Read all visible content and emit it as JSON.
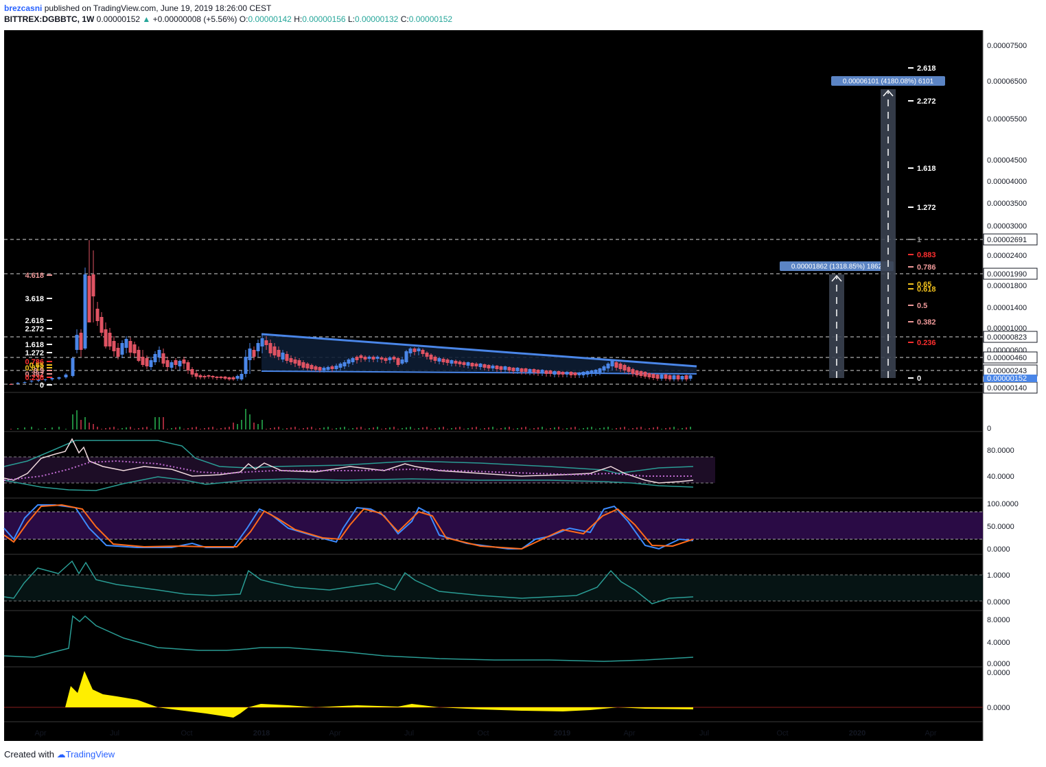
{
  "header": {
    "user": "brezcasni",
    "published": "published on TradingView.com, June 19, 2019 18:26:00 CEST",
    "symbol": "BITTREX:DGBBTC, 1W",
    "price": "0.00000152",
    "change": "+0.00000008 (+5.56%)",
    "o_label": "O:",
    "o_value": "0.00000142",
    "h_label": "H:",
    "h_value": "0.00000156",
    "l_label": "L:",
    "l_value": "0.00000132",
    "c_label": "C:",
    "c_value": "0.00000152"
  },
  "footer": {
    "created": "Created with",
    "brand": "TradingView"
  },
  "colors": {
    "background": "#000000",
    "bull": "#4a86e8",
    "bear": "#e05363",
    "trendline": "#4a86e8",
    "stoch_k": "#3d8bff",
    "stoch_d": "#ff6b1a",
    "teal": "#2a9d95",
    "yellow": "#ffee00",
    "rsi": "#f3dce0",
    "rsi_ma": "#c46ed6",
    "fib_white": "#ffffff",
    "fib_red": "#ff2f2f",
    "fib_pink": "#f09a9a",
    "fib_gold": "#f2c21d"
  },
  "x_axis_labels": [
    "Apr",
    "Jul",
    "Oct",
    "2018",
    "Apr",
    "Jul",
    "Oct",
    "2019",
    "Apr",
    "Jul",
    "Oct",
    "2020",
    "Apr"
  ],
  "price_axis": {
    "ticks": [
      "0.00007500",
      "0.00006500",
      "0.00005500",
      "0.00004500",
      "0.00004000",
      "0.00003500",
      "0.00003000",
      "0.00002400",
      "0.00001800",
      "0.00001400",
      "0.00001000",
      "0.00000600"
    ],
    "boxed": [
      "0.00002691",
      "0.00001990",
      "0.00000823",
      "0.00000460",
      "0.00000243",
      "0.00000140"
    ],
    "current": "0.00000152"
  },
  "volume_axis": [
    "0"
  ],
  "rsi_axis": [
    "80.0000",
    "40.0000"
  ],
  "stoch_axis": [
    "100.0000",
    "50.0000",
    "0.0000"
  ],
  "osc3_axis": [
    "1.0000",
    "0.0000"
  ],
  "osc4_axis": [
    "8.0000",
    "4.0000",
    "0.0000"
  ],
  "osc5_axis": [
    "0.0000",
    "0.0000"
  ],
  "fib_right": [
    "2.618",
    "2.272",
    "1.618",
    "1.272",
    "1",
    "0.883",
    "0.786",
    "0.65",
    "0.618",
    "0.5",
    "0.382",
    "0.236",
    "0"
  ],
  "fib_left": [
    "4.618",
    "3.618",
    "2.618",
    "2.272",
    "1.618",
    "1.272",
    "0.786",
    "0.65",
    "0.618",
    "0.5",
    "0.382",
    "0.236",
    "0"
  ],
  "projection_1": "0.00001862 (1318.85%) 1862",
  "projection_2": "0.00006101 (4180.08%) 6101",
  "chart_data": {
    "type": "candlestick",
    "symbol": "BITTREX:DGBBTC",
    "interval": "1W",
    "scale": "log",
    "last": {
      "open": 1.42e-06,
      "high": 1.56e-06,
      "low": 1.32e-06,
      "close": 1.52e-06,
      "change": 8e-08,
      "change_pct": 5.56
    },
    "price_levels_marked": [
      2.691e-05,
      1.99e-05,
      8.23e-06,
      4.6e-06,
      2.43e-06,
      1.4e-06
    ],
    "projections": [
      {
        "target": 1.862e-05,
        "pct": 1318.85,
        "ticks": 1862
      },
      {
        "target": 6.101e-05,
        "pct": 4180.08,
        "ticks": 6101
      }
    ],
    "candles_approx": [
      {
        "t": "2017-03",
        "o": 3e-07,
        "h": 4e-07,
        "l": 2e-07,
        "c": 4e-07
      },
      {
        "t": "2017-04",
        "o": 4e-07,
        "h": 7e-07,
        "l": 3e-07,
        "c": 6e-07
      },
      {
        "t": "2017-05",
        "o": 6e-07,
        "h": 8.8e-06,
        "l": 5e-07,
        "c": 7.5e-06
      },
      {
        "t": "2017-05b",
        "o": 7.5e-06,
        "h": 1.2e-05,
        "l": 5.2e-06,
        "c": 8.2e-06
      },
      {
        "t": "2017-06",
        "o": 8.2e-06,
        "h": 2.7e-05,
        "l": 7.8e-06,
        "c": 1.99e-05
      },
      {
        "t": "2017-06b",
        "o": 1.99e-05,
        "h": 2.4e-05,
        "l": 1.1e-05,
        "c": 1.25e-05
      },
      {
        "t": "2017-07",
        "o": 1.25e-05,
        "h": 1.35e-05,
        "l": 7.2e-06,
        "c": 8.5e-06
      },
      {
        "t": "2017-08",
        "o": 8.5e-06,
        "h": 9.5e-06,
        "l": 5.5e-06,
        "c": 6.5e-06
      },
      {
        "t": "2017-09",
        "o": 6.5e-06,
        "h": 7.5e-06,
        "l": 4.2e-06,
        "c": 4.7e-06
      },
      {
        "t": "2017-10",
        "o": 4.7e-06,
        "h": 5.2e-06,
        "l": 2.8e-06,
        "c": 3.1e-06
      },
      {
        "t": "2017-11",
        "o": 3.1e-06,
        "h": 3.4e-06,
        "l": 1.9e-06,
        "c": 2.1e-06
      },
      {
        "t": "2017-12",
        "o": 2.1e-06,
        "h": 6.2e-06,
        "l": 1.9e-06,
        "c": 5.8e-06
      },
      {
        "t": "2018-01",
        "o": 5.8e-06,
        "h": 8.6e-06,
        "l": 4.6e-06,
        "c": 7.2e-06
      },
      {
        "t": "2018-02",
        "o": 7.2e-06,
        "h": 7.6e-06,
        "l": 3.8e-06,
        "c": 4.3e-06
      },
      {
        "t": "2018-03",
        "o": 4.3e-06,
        "h": 4.6e-06,
        "l": 2.4e-06,
        "c": 2.6e-06
      },
      {
        "t": "2018-04",
        "o": 2.6e-06,
        "h": 4.7e-06,
        "l": 2.4e-06,
        "c": 4.4e-06
      },
      {
        "t": "2018-05",
        "o": 4.4e-06,
        "h": 4.9e-06,
        "l": 3.6e-06,
        "c": 4e-06
      },
      {
        "t": "2018-06",
        "o": 4e-06,
        "h": 6.2e-06,
        "l": 3.4e-06,
        "c": 5.8e-06
      },
      {
        "t": "2018-07",
        "o": 5.8e-06,
        "h": 6.4e-06,
        "l": 4.4e-06,
        "c": 4.8e-06
      },
      {
        "t": "2018-09",
        "o": 4.4e-06,
        "h": 4.6e-06,
        "l": 2.9e-06,
        "c": 3.1e-06
      },
      {
        "t": "2018-11",
        "o": 3e-06,
        "h": 3.3e-06,
        "l": 2.4e-06,
        "c": 2.6e-06
      },
      {
        "t": "2019-01",
        "o": 2.6e-06,
        "h": 2.9e-06,
        "l": 2.3e-06,
        "c": 2.7e-06
      },
      {
        "t": "2019-03",
        "o": 2.8e-06,
        "h": 3.6e-06,
        "l": 2.6e-06,
        "c": 3.1e-06
      },
      {
        "t": "2019-05",
        "o": 2.3e-06,
        "h": 2.5e-06,
        "l": 1.4e-06,
        "c": 1.6e-06
      },
      {
        "t": "2019-06",
        "o": 1.42e-06,
        "h": 1.56e-06,
        "l": 1.32e-06,
        "c": 1.52e-06
      }
    ]
  }
}
